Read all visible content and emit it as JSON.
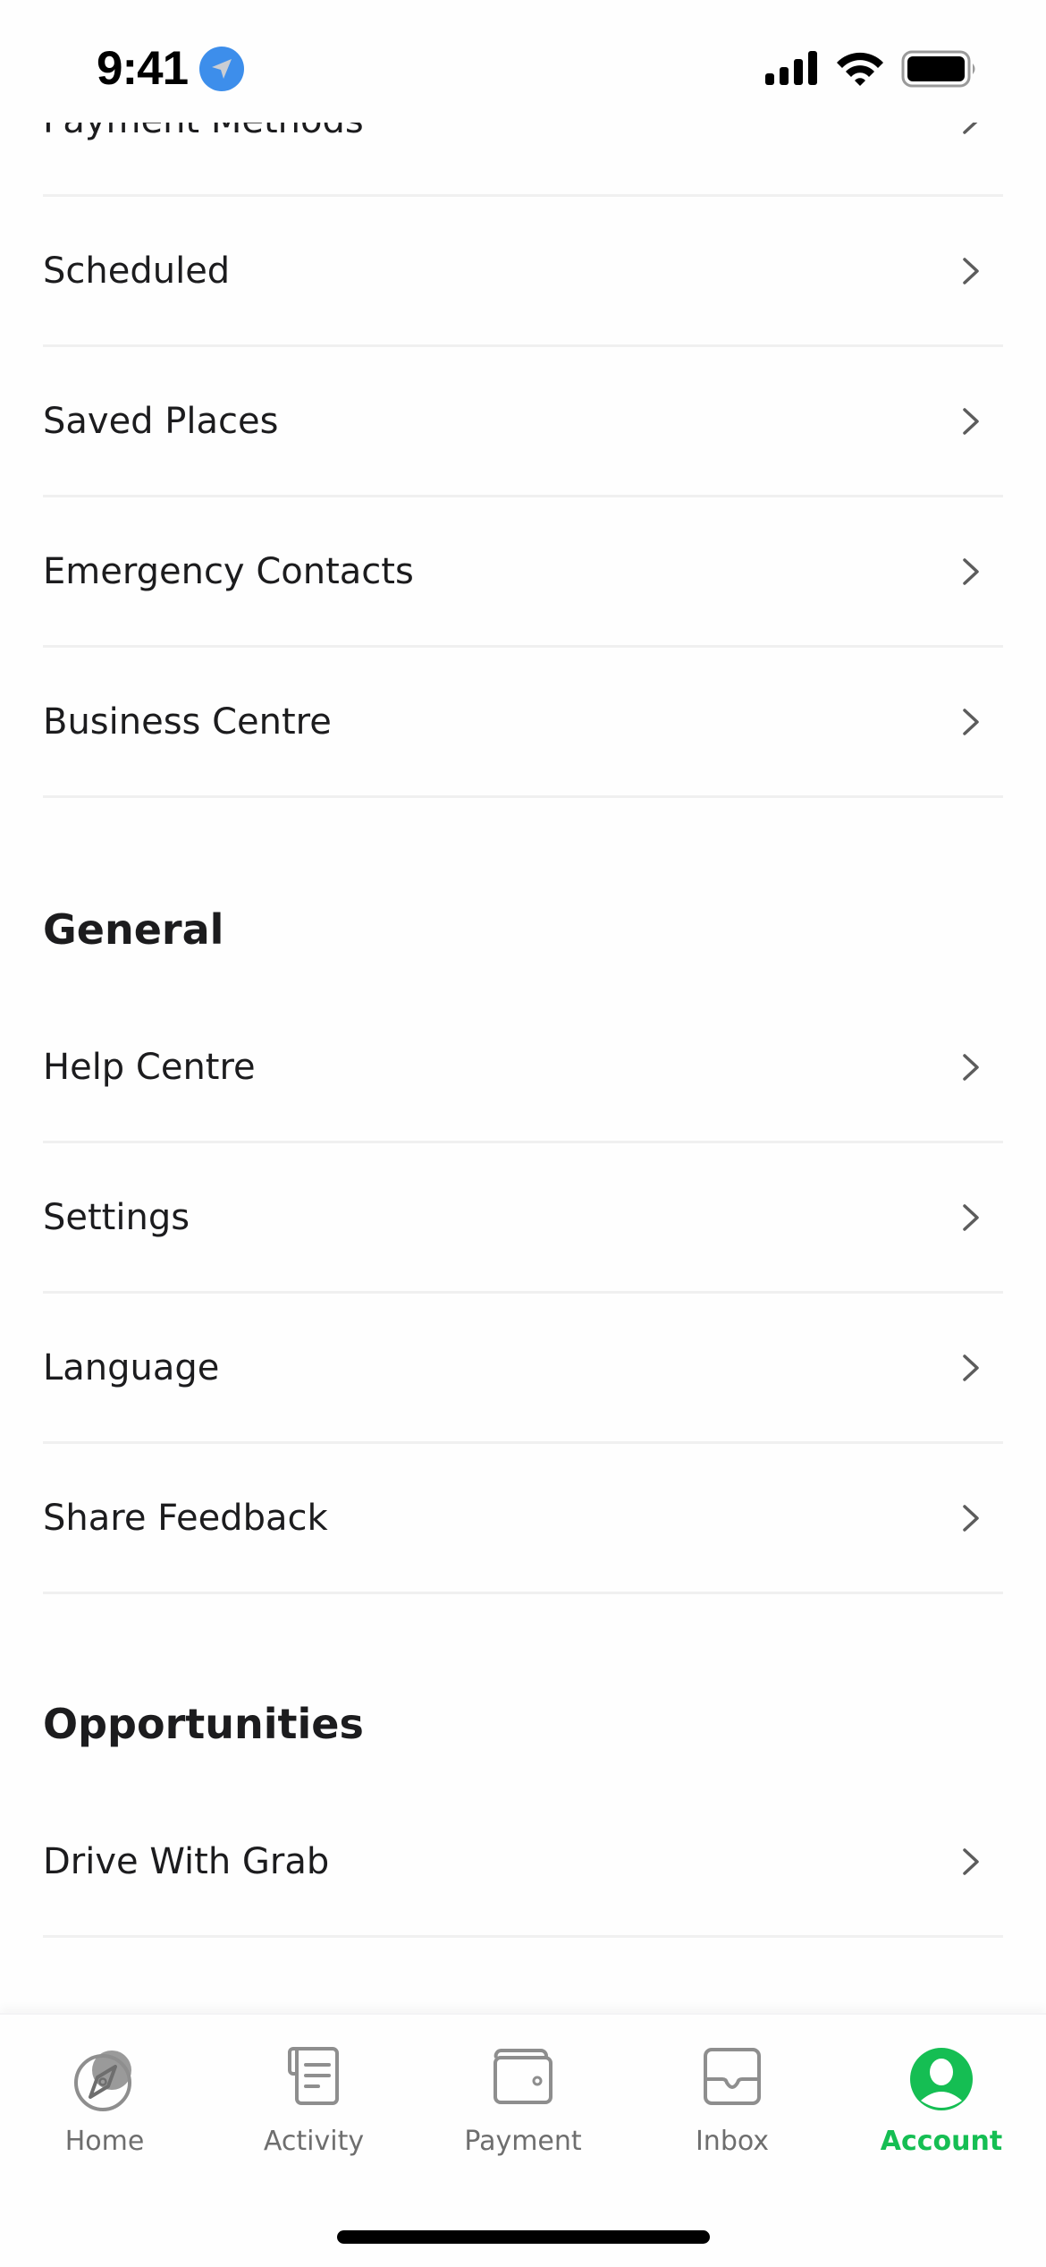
{
  "status_bar": {
    "time": "9:41",
    "icons": [
      "location-arrow-icon",
      "signal-icon",
      "wifi-icon",
      "battery-icon"
    ]
  },
  "account_rows": [
    {
      "label": "Payment Methods"
    },
    {
      "label": "Scheduled"
    },
    {
      "label": "Saved Places"
    },
    {
      "label": "Emergency Contacts"
    },
    {
      "label": "Business Centre"
    }
  ],
  "sections": {
    "general": {
      "title": "General",
      "rows": [
        {
          "label": "Help Centre"
        },
        {
          "label": "Settings"
        },
        {
          "label": "Language"
        },
        {
          "label": "Share Feedback"
        }
      ]
    },
    "opportunities": {
      "title": "Opportunities",
      "rows": [
        {
          "label": "Drive With Grab"
        }
      ]
    }
  },
  "tabbar": {
    "active": "Account",
    "accent_color": "#15BE53",
    "tabs": [
      {
        "label": "Home",
        "icon": "home-compass-icon"
      },
      {
        "label": "Activity",
        "icon": "activity-receipt-icon"
      },
      {
        "label": "Payment",
        "icon": "wallet-icon"
      },
      {
        "label": "Inbox",
        "icon": "inbox-tray-icon"
      },
      {
        "label": "Account",
        "icon": "account-person-icon"
      }
    ]
  }
}
